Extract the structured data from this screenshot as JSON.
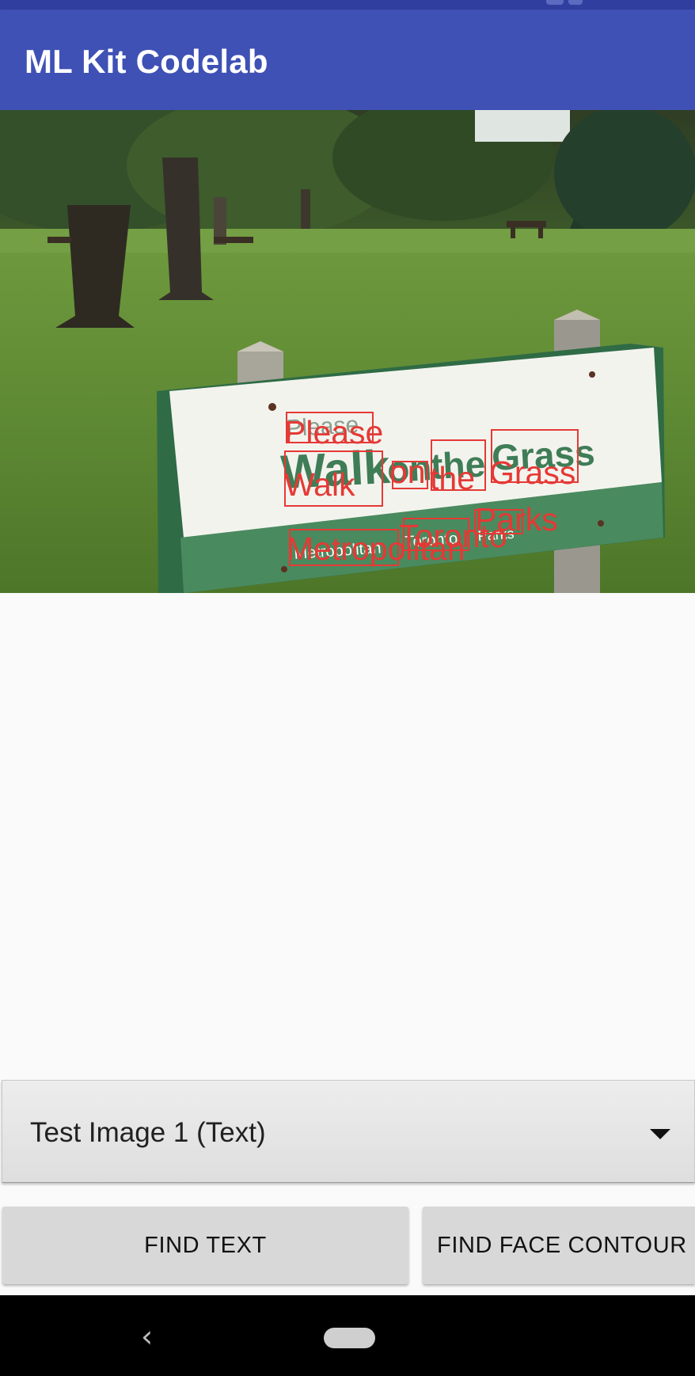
{
  "app": {
    "title": "ML Kit Codelab"
  },
  "image": {
    "description_icon": "park-sign-photo",
    "sign_text": [
      "Please",
      "Walk",
      "on",
      "the",
      "Grass",
      "Metropolitan",
      "Toronto",
      "Parks"
    ],
    "detected_labels": [
      "Please",
      "Walk",
      "on",
      "the",
      "Grass",
      "Metropolitan",
      "Toronto",
      "Parks"
    ],
    "overlay_color": "#e53935"
  },
  "spinner": {
    "selected": "Test Image 1 (Text)",
    "icon": "dropdown-arrow-icon"
  },
  "buttons": {
    "find_text": "FIND TEXT",
    "find_face_contour": "FIND FACE CONTOUR"
  },
  "nav": {
    "back_icon": "back-icon",
    "home_icon": "home-pill-icon"
  },
  "colors": {
    "primary": "#3f51b5",
    "primary_dark": "#303f9f",
    "button_bg": "#d8d8d8",
    "sign_green": "#4a8a5f"
  }
}
